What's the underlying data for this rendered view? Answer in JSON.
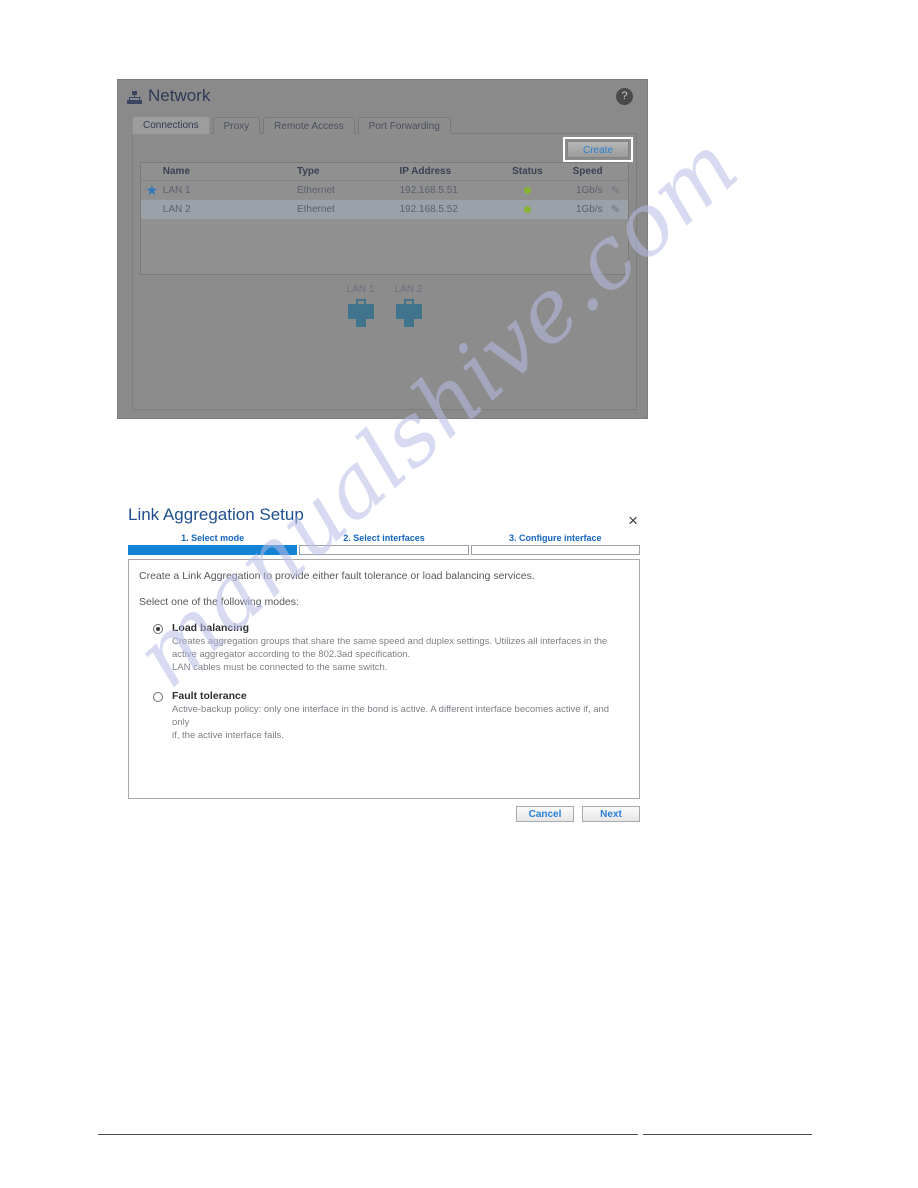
{
  "watermark": {
    "text": "manualshive.com"
  },
  "network_window": {
    "title": "Network",
    "icon": "network-sitemap-icon",
    "help_icon": "?",
    "tabs": [
      {
        "label": "Connections",
        "active": true
      },
      {
        "label": "Proxy",
        "active": false
      },
      {
        "label": "Remote Access",
        "active": false
      },
      {
        "label": "Port Forwarding",
        "active": false
      }
    ],
    "create_label": "Create",
    "table": {
      "columns": [
        "Name",
        "Type",
        "IP Address",
        "Status",
        "Speed"
      ],
      "rows": [
        {
          "favorite": true,
          "name": "LAN 1",
          "type": "Ethernet",
          "ip": "192.168.5.51",
          "status": "online",
          "speed": "1Gb/s",
          "selected": false
        },
        {
          "favorite": false,
          "name": "LAN 2",
          "type": "Ethernet",
          "ip": "192.168.5.52",
          "status": "online",
          "speed": "1Gb/s",
          "selected": true
        }
      ]
    },
    "ports": [
      {
        "label": "LAN 1"
      },
      {
        "label": "LAN 2"
      }
    ],
    "colors": {
      "status_online": "#86b531",
      "link_blue": "#2a7fd4",
      "port_teal": "#40738c",
      "star_blue": "#2f79bd"
    }
  },
  "lag_dialog": {
    "title": "Link Aggregation Setup",
    "close_label": "×",
    "steps": [
      {
        "label": "1. Select mode",
        "active": true
      },
      {
        "label": "2. Select interfaces",
        "active": false
      },
      {
        "label": "3. Configure interface",
        "active": false
      }
    ],
    "intro": "Create a Link Aggregation to provide either fault tolerance or load balancing services.",
    "select_prompt": "Select one of the following modes:",
    "modes": [
      {
        "name": "Load balancing",
        "selected": true,
        "desc_line1": "Creates aggregation groups that share the same speed and duplex settings. Utilizes all interfaces in the",
        "desc_line2": "active aggregator according to the 802.3ad specification.",
        "desc_line3": "LAN cables must be connected to the same switch."
      },
      {
        "name": "Fault tolerance",
        "selected": false,
        "desc_line1": "Active-backup policy: only one interface in the bond is active. A different interface becomes active if, and only",
        "desc_line2": "if, the active interface fails.",
        "desc_line3": ""
      }
    ],
    "cancel_label": "Cancel",
    "next_label": "Next",
    "colors": {
      "title_blue": "#1f4f8f",
      "step_active": "#1583d4",
      "step_label": "#1565c0",
      "button_text": "#2a7fd4"
    }
  }
}
